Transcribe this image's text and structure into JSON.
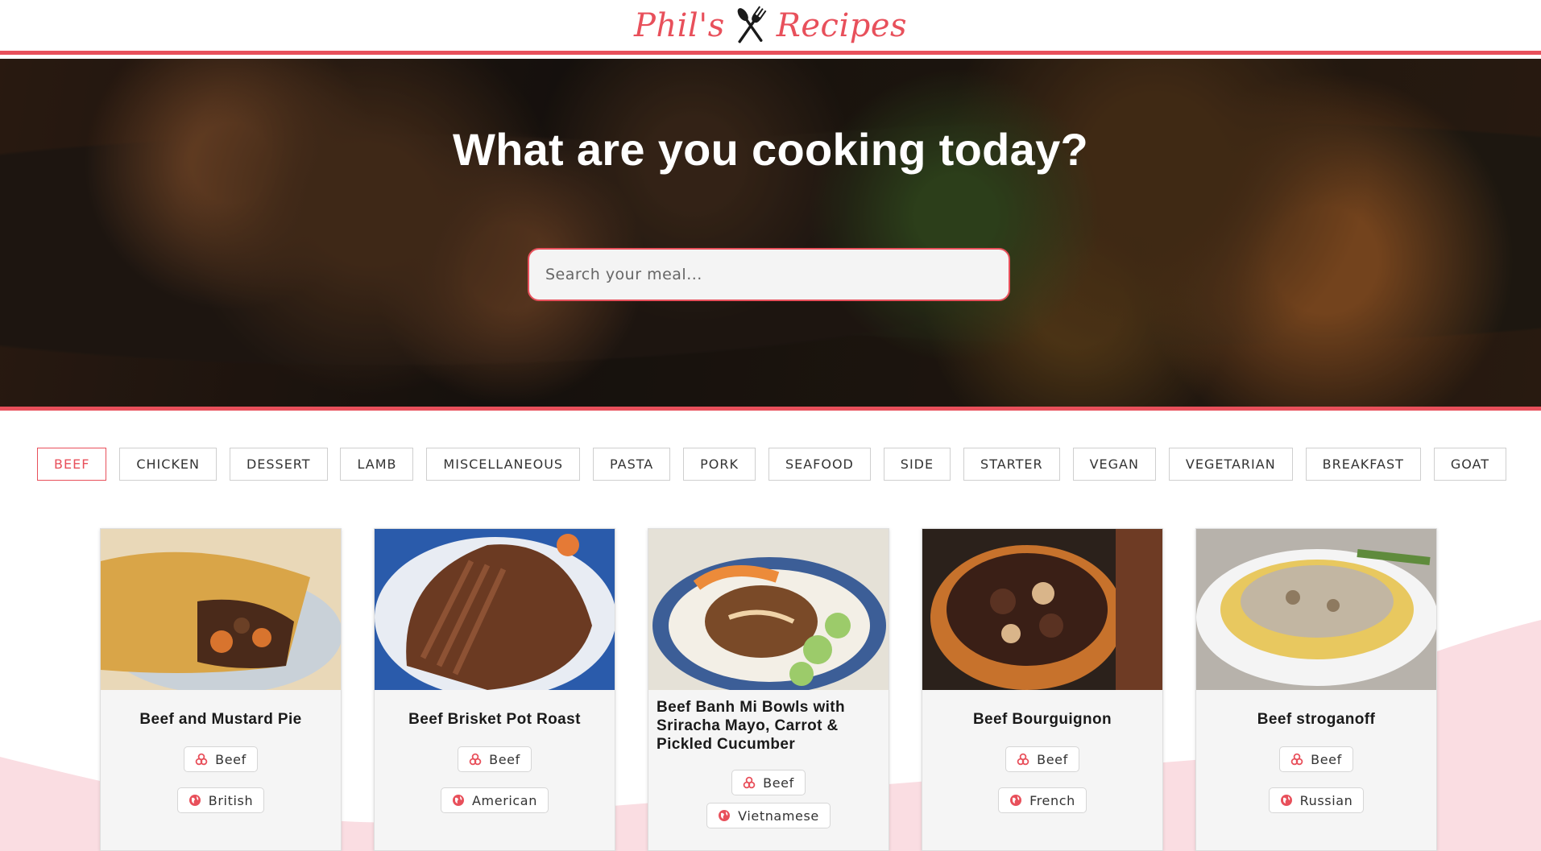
{
  "header": {
    "logo_left": "Phil's",
    "logo_right": "Recipes",
    "logo_icon": "fork-knife-icon"
  },
  "hero": {
    "title": "What are you cooking today?",
    "search_placeholder": "Search your meal...",
    "search_value": ""
  },
  "categories": [
    {
      "label": "BEEF",
      "active": true
    },
    {
      "label": "CHICKEN",
      "active": false
    },
    {
      "label": "DESSERT",
      "active": false
    },
    {
      "label": "LAMB",
      "active": false
    },
    {
      "label": "MISCELLANEOUS",
      "active": false
    },
    {
      "label": "PASTA",
      "active": false
    },
    {
      "label": "PORK",
      "active": false
    },
    {
      "label": "SEAFOOD",
      "active": false
    },
    {
      "label": "SIDE",
      "active": false
    },
    {
      "label": "STARTER",
      "active": false
    },
    {
      "label": "VEGAN",
      "active": false
    },
    {
      "label": "VEGETARIAN",
      "active": false
    },
    {
      "label": "BREAKFAST",
      "active": false
    },
    {
      "label": "GOAT",
      "active": false
    }
  ],
  "recipes": [
    {
      "title": "Beef and Mustard Pie",
      "category": "Beef",
      "area": "British"
    },
    {
      "title": "Beef Brisket Pot Roast",
      "category": "Beef",
      "area": "American"
    },
    {
      "title": "Beef Banh Mi Bowls with Sriracha Mayo, Carrot & Pickled Cucumber",
      "category": "Beef",
      "area": "Vietnamese"
    },
    {
      "title": "Beef Bourguignon",
      "category": "Beef",
      "area": "French"
    },
    {
      "title": "Beef stroganoff",
      "category": "Beef",
      "area": "Russian"
    }
  ],
  "icons": {
    "category_tag": "category-icon",
    "area_tag": "globe-icon"
  },
  "colors": {
    "accent": "#e8505b",
    "wave": "#fadde2"
  }
}
